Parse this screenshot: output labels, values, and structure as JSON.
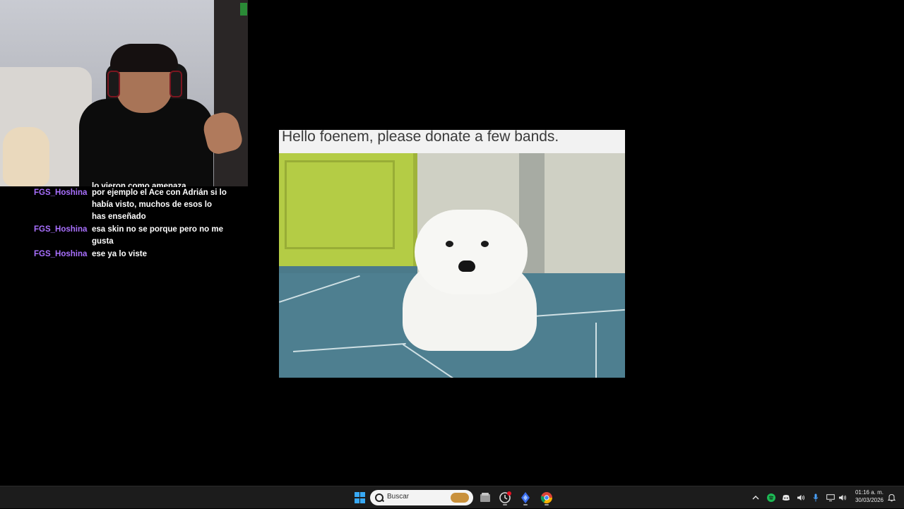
{
  "stream": {
    "chat": {
      "cut_line": "lo vieron como amenaza",
      "messages": [
        {
          "user": "FGS_Hoshina",
          "text": "por ejemplo el Ace con Adrián si lo había visto, muchos de esos lo has enseñado"
        },
        {
          "user": "FGS_Hoshina",
          "text": "esa skin no se porque pero no me gusta"
        },
        {
          "user": "FGS_Hoshina",
          "text": "ese ya lo viste"
        }
      ],
      "username_color": "#a970ff"
    },
    "donation": {
      "caption": "Hello foenem, please donate a few bands."
    }
  },
  "taskbar": {
    "start_icon": "windows-start-icon",
    "search_placeholder": "Buscar",
    "apps": [
      "file-explorer-icon",
      "game-launcher-icon",
      "app-diamond-icon",
      "chrome-icon"
    ],
    "tray": {
      "overflow": "chevron-up-icon",
      "icons": [
        "spotify-icon",
        "discord-icon",
        "speaker-icon",
        "microphone-icon",
        "display-icon",
        "volume-icon"
      ],
      "time": "01:16 a. m.",
      "date": "30/03/2026",
      "notification": "notification-bell-icon"
    }
  },
  "colors": {
    "background": "#000000",
    "taskbar": "#1c1c1c",
    "accent": "#38a9f5"
  }
}
